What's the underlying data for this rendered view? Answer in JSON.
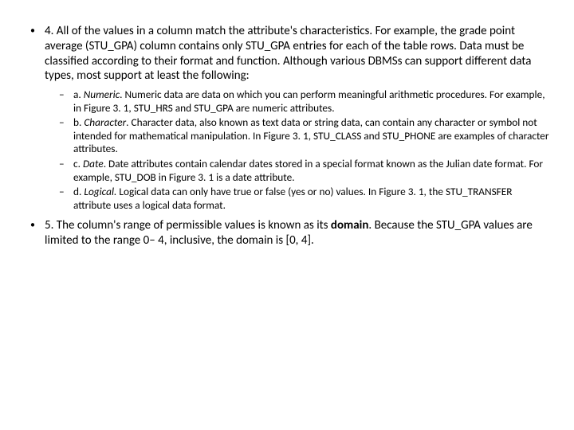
{
  "items": [
    {
      "prefix": "4. ",
      "text": "All of the values in a column match the attribute's characteristics. For example, the grade point average (STU_GPA) column contains only STU_GPA entries for each of the table rows. Data must be classified according to their format and function. Although various DBMSs can support different data types, most support at least the following:",
      "subitems": [
        {
          "prefix": "a. ",
          "term": "Numeric",
          "rest": ". Numeric data are data on which you can perform meaningful arithmetic procedures. For example, in Figure 3. 1, STU_HRS and STU_GPA are numeric attributes."
        },
        {
          "prefix": "b. ",
          "term": "Character",
          "rest": ". Character data, also known as text data or string data, can contain any character or symbol not intended for mathematical manipulation. In Figure 3. 1, STU_CLASS and STU_PHONE are examples of character attributes."
        },
        {
          "prefix": "c. ",
          "term": "Date",
          "rest": ". Date attributes contain calendar dates stored in a special format known as the Julian date format. For example, STU_DOB in Figure 3. 1 is a date attribute."
        },
        {
          "prefix": "d. ",
          "term": "Logical.",
          "rest": " Logical data can only have true or false (yes or no) values. In Figure 3. 1, the STU_TRANSFER attribute uses a logical data format."
        }
      ]
    }
  ],
  "item5_prefix": "5. ",
  "item5_a": "The column's range of permissible values is known as its ",
  "item5_bold": "domain",
  "item5_b": ". Because the STU_GPA values are limited to the range 0– 4, inclusive, the domain is [0, 4]."
}
